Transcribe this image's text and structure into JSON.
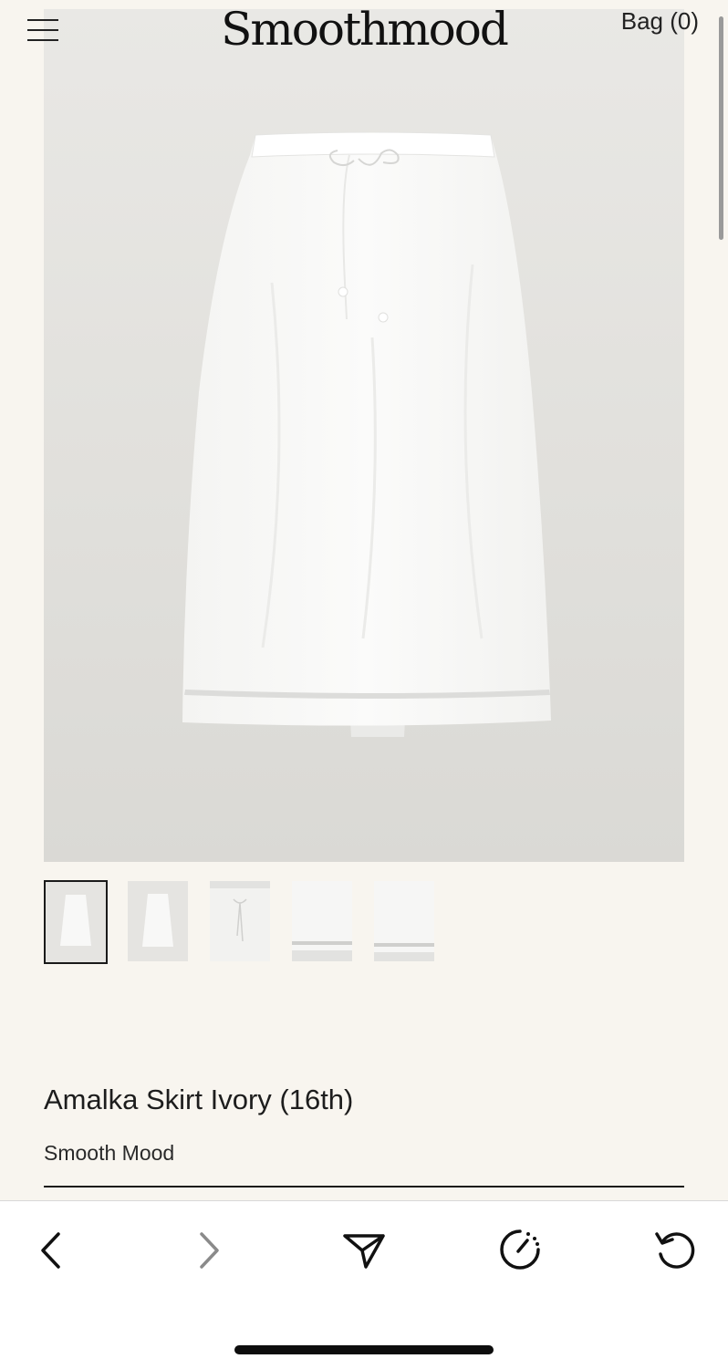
{
  "header": {
    "logo": "Smoothmood",
    "bag_label": "Bag (0)"
  },
  "icons": {
    "menu": "hamburger-menu-icon",
    "back": "chevron-left-icon",
    "forward": "chevron-right-icon",
    "share": "send-icon",
    "timer": "timer-icon",
    "reload": "reload-icon"
  },
  "gallery": {
    "thumbnails": [
      {
        "view": "full-front",
        "active": true
      },
      {
        "view": "full-back",
        "active": false
      },
      {
        "view": "waistband-tie",
        "active": false
      },
      {
        "view": "hem-detail",
        "active": false
      },
      {
        "view": "hem-back",
        "active": false
      }
    ]
  },
  "product": {
    "title": "Amalka Skirt Ivory (16th)",
    "brand": "Smooth Mood"
  },
  "colors": {
    "page_bg": "#f8f5ef",
    "photo_bg": "#e3e2df",
    "text": "#1a1a1a"
  }
}
